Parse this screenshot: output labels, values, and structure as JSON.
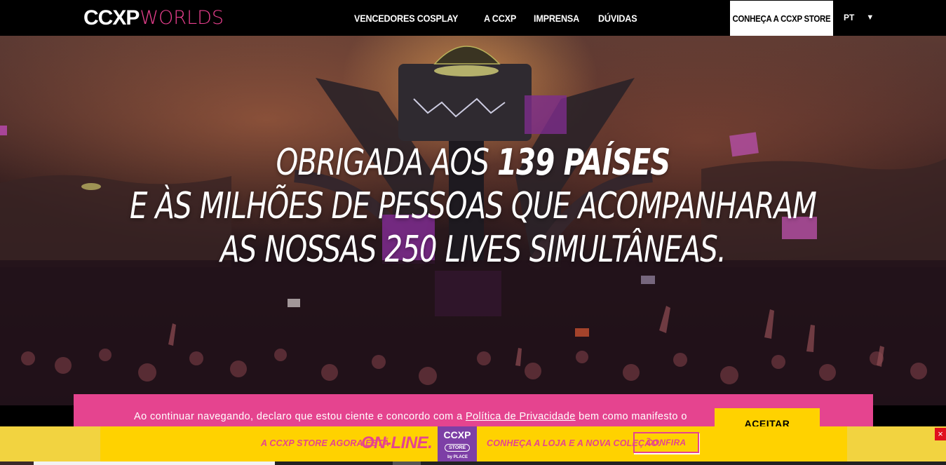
{
  "header": {
    "logo": {
      "primary": "CCXP",
      "secondary": "WORLDS"
    },
    "nav": [
      {
        "label": "VENCEDORES COSPLAY"
      },
      {
        "label": "A CCXP"
      },
      {
        "label": "IMPRENSA"
      },
      {
        "label": "DÚVIDAS"
      }
    ],
    "store_button": "CONHEÇA A CCXP STORE",
    "language": {
      "label": "PT",
      "caret": "▼"
    }
  },
  "hero": {
    "line1_light": "OBRIGADA AOS ",
    "line1_bold": "139 PAÍSES",
    "line2": "E ÀS MILHÕES DE PESSOAS QUE ACOMPANHARAM",
    "line3": "AS NOSSAS 250 LIVES SIMULTÂNEAS."
  },
  "cookie_banner": {
    "text_before": "Ao continuar navegando, declaro que estou ciente e concordo com a ",
    "link": "Política de Privacidade",
    "text_after": " bem como manifesto o",
    "accept_button": "ACEITAR"
  },
  "promo_bar": {
    "text_left": "A CCXP STORE AGORA ESTÁ",
    "highlight": "ON-LINE.",
    "badge": {
      "title": "CCXP",
      "subtitle": "STORE",
      "partner": "by PLACE"
    },
    "text_right": "CONHEÇA A LOJA E A NOVA COLEÇÃO.",
    "cta_button": "CONFIRA",
    "close": "×"
  },
  "colors": {
    "brand_pink": "#e5448f",
    "brand_yellow": "#ffd200",
    "brand_purple": "#7d3fa6",
    "header_bg": "#000000"
  }
}
